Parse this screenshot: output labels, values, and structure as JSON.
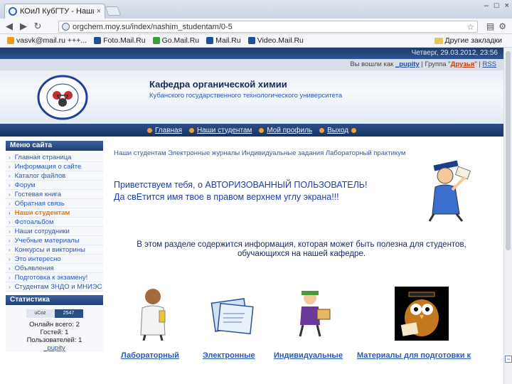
{
  "browser": {
    "tab_title": "КОиЛ КубГТУ - Наши студ",
    "tab_close": "×",
    "url": "orgchem.moy.su/index/nashim_studentam/0-5",
    "win_min": "–",
    "win_max": "□",
    "win_close": "×",
    "bookmarks": [
      {
        "label": "vasvk@mail.ru +++...",
        "icon": "mail-icon"
      },
      {
        "label": "Foto.Mail.Ru",
        "icon": "photo-icon"
      },
      {
        "label": "Go.Mail.Ru",
        "icon": "search-icon"
      },
      {
        "label": "Mail.Ru",
        "icon": "mail-icon"
      },
      {
        "label": "Video.Mail.Ru",
        "icon": "video-icon"
      }
    ],
    "other_bookmarks": "Другие закладки"
  },
  "site": {
    "date": "Четверг, 29.03.2012, 23:56",
    "user_prefix": "Вы вошли как",
    "username": "_pupity",
    "group_prefix": "| Группа \"",
    "group": "Друзья",
    "group_suffix": "\" |",
    "rss": "RSS",
    "dept_title": "Кафедра органической химии",
    "univ": "Кубанского государственного технологического университета",
    "nav": [
      "Главная",
      "Наши студентам",
      "Мой профиль",
      "Выход"
    ]
  },
  "sidebar": {
    "menu_title": "Меню сайта",
    "items": [
      {
        "label": "Главная страница",
        "active": false
      },
      {
        "label": "Информация о сайте",
        "active": false
      },
      {
        "label": "Каталог файлов",
        "active": false
      },
      {
        "label": "Форум",
        "active": false
      },
      {
        "label": "Гостевая книга",
        "active": false
      },
      {
        "label": "Обратная связь",
        "active": false
      },
      {
        "label": "Наши студентам",
        "active": true
      },
      {
        "label": "Фотоальбом",
        "active": false
      },
      {
        "label": "Наши сотрудники",
        "active": false
      },
      {
        "label": "Учебные материалы",
        "active": false
      },
      {
        "label": "Конкурсы и викторины",
        "active": false
      },
      {
        "label": "Это интересно",
        "active": false
      },
      {
        "label": "Объявления",
        "active": false
      },
      {
        "label": "Подготовка к экзамену!",
        "active": false
      },
      {
        "label": "Студентам ЗНДО и МНИЭС",
        "active": false
      }
    ],
    "stats_title": "Статистика",
    "counter_left": "uCoz",
    "counter_right": "2547",
    "online": "Онлайн всего: 2",
    "guests": "Гостей: 1",
    "users": "Пользователей: 1",
    "user_link": "_pupity"
  },
  "main": {
    "crumbs": "Наши студентам   Электронные журналы   Индивидуальные задания   Лабораторный практикум",
    "hello1": "Приветствуем тебя, о АВТОРИЗОВАННЫЙ ПОЛЬЗОВАТЕЛЬ!",
    "hello2": "Да свЕтится имя твое в правом верхнем углу экрана!!!",
    "info1": "В этом разделе содержится информация, которая может быть полезна для студентов,",
    "info2": "обучающихся на нашей кафедре.",
    "captions": [
      "Лабораторный",
      "Электронные",
      "Индивидуальные",
      "Материалы для подготовки к"
    ]
  },
  "colors": {
    "header_dark": "#1d3a6b",
    "link": "#2a58b8",
    "active": "#e07a10"
  }
}
